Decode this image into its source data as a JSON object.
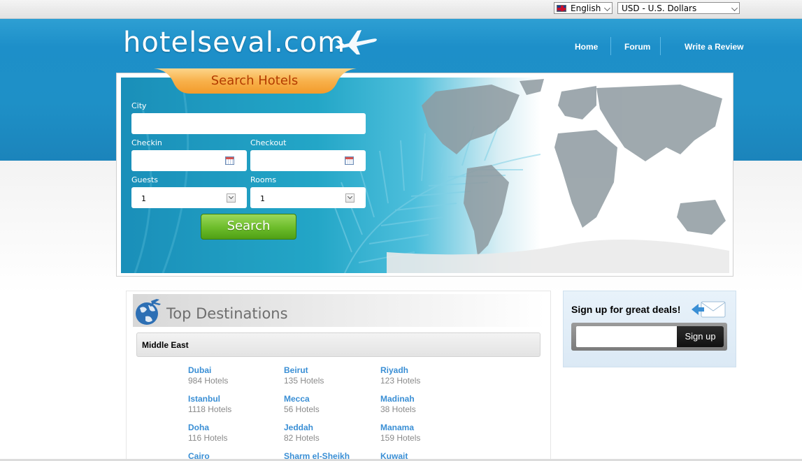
{
  "topbar": {
    "language": "English",
    "currency": "USD - U.S. Dollars"
  },
  "header": {
    "logo": "hotelseval.com",
    "nav": [
      "Home",
      "Forum",
      "Write a Review"
    ]
  },
  "search": {
    "tab_label": "Search Hotels",
    "city_label": "City",
    "city_value": "",
    "checkin_label": "Checkin",
    "checkin_value": "",
    "checkout_label": "Checkout",
    "checkout_value": "",
    "guests_label": "Guests",
    "guests_value": "1",
    "rooms_label": "Rooms",
    "rooms_value": "1",
    "button_label": "Search"
  },
  "destinations": {
    "title": "Top Destinations",
    "region": "Middle East",
    "cities": [
      {
        "name": "Dubai",
        "count": "984 Hotels"
      },
      {
        "name": "Beirut",
        "count": "135 Hotels"
      },
      {
        "name": "Riyadh",
        "count": "123 Hotels"
      },
      {
        "name": "Istanbul",
        "count": "1118 Hotels"
      },
      {
        "name": "Mecca",
        "count": "56 Hotels"
      },
      {
        "name": "Madinah",
        "count": "38 Hotels"
      },
      {
        "name": "Doha",
        "count": "116 Hotels"
      },
      {
        "name": "Jeddah",
        "count": "82 Hotels"
      },
      {
        "name": "Manama",
        "count": "159 Hotels"
      },
      {
        "name": "Cairo",
        "count": ""
      },
      {
        "name": "Sharm el-Sheikh",
        "count": ""
      },
      {
        "name": "Kuwait",
        "count": ""
      }
    ]
  },
  "signup": {
    "title": "Sign up for great deals!",
    "input_value": "",
    "button_label": "Sign up"
  },
  "icons": {
    "flag": "uk-flag-icon",
    "plane": "airplane-icon",
    "calendar": "calendar-icon",
    "globe": "globe-icon",
    "envelope": "envelope-icon"
  },
  "colors": {
    "header_blue": "#1d8fc9",
    "search_tab_orange": "#f5a43c",
    "search_button_green": "#6cbc2a",
    "city_link_blue": "#3a8fd5",
    "signup_button": "#1a1a1a"
  }
}
